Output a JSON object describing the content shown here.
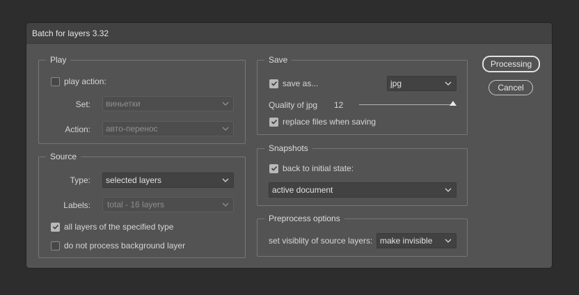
{
  "window": {
    "title": "Batch for layers 3.32"
  },
  "play": {
    "legend": "Play",
    "play_action": {
      "label": "play action:",
      "checked": false
    },
    "set": {
      "label": "Set:",
      "value": "виньетки",
      "enabled": false
    },
    "action": {
      "label": "Action:",
      "value": "авто-перенос",
      "enabled": false
    }
  },
  "source": {
    "legend": "Source",
    "type": {
      "label": "Type:",
      "value": "selected layers"
    },
    "labels": {
      "label": "Labels:",
      "value": "total - 16 layers",
      "enabled": false
    },
    "all_layers": {
      "label": "all layers of the specified type",
      "checked": true
    },
    "no_background": {
      "label": "do not process background layer",
      "checked": false
    }
  },
  "save": {
    "legend": "Save",
    "save_as": {
      "label": "save as...",
      "checked": true
    },
    "format": {
      "value": "jpg"
    },
    "quality": {
      "label": "Quality of jpg",
      "value": "12",
      "max": 12
    },
    "replace": {
      "label": "replace files when saving",
      "checked": true
    }
  },
  "snapshots": {
    "legend": "Snapshots",
    "back_initial": {
      "label": "back to initial state:",
      "checked": true
    },
    "document": {
      "value": "active document"
    }
  },
  "preprocess": {
    "legend": "Preprocess options",
    "visibility": {
      "label": "set visiblity of source layers:",
      "value": "make invisible"
    }
  },
  "buttons": {
    "processing": "Processing",
    "cancel": "Cancel"
  },
  "colors": {
    "dialog_bg": "#535353",
    "titlebar_bg": "#424242",
    "field_bg": "#424242",
    "backdrop": "#2d2d2d"
  }
}
